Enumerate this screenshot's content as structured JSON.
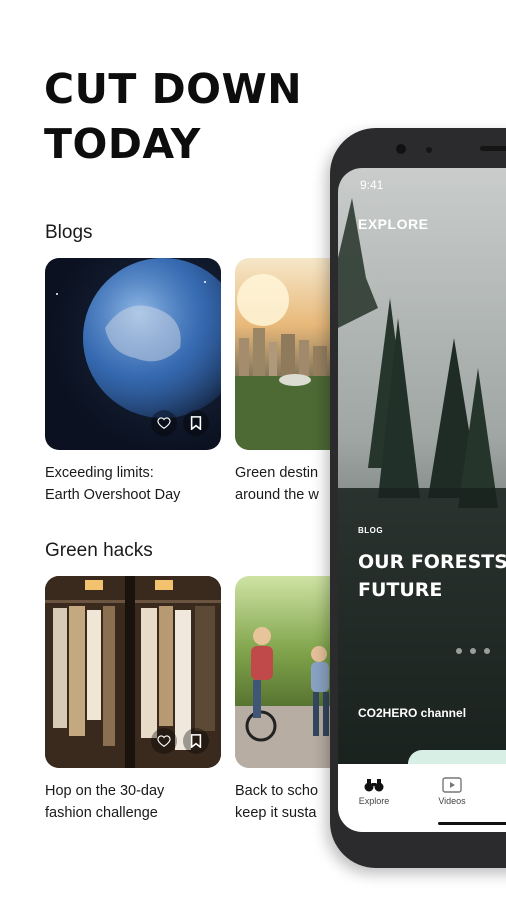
{
  "headline": {
    "line1": "CUT DOWN",
    "line2": "TODAY"
  },
  "blogs": {
    "title": "Blogs",
    "items": [
      {
        "caption": "Exceeding limits:\nEarth Overshoot Day"
      },
      {
        "caption": "Green destin\naround the w"
      }
    ]
  },
  "green_hacks": {
    "title": "Green hacks",
    "items": [
      {
        "caption": "Hop on the 30-day\nfashion challenge"
      },
      {
        "caption": "Back to scho\nkeep it susta"
      }
    ]
  },
  "phone": {
    "time": "9:41",
    "section": "EXPLORE",
    "tag": "BLOG",
    "hero_title": "OUR FORESTS\nFUTURE",
    "channel": "CO2HERO channel",
    "tabs": [
      {
        "label": "Explore",
        "icon": "binoculars-icon"
      },
      {
        "label": "Videos",
        "icon": "video-icon"
      }
    ]
  },
  "colors": {
    "text": "#111111",
    "accent_panel": "#d7efe4"
  }
}
